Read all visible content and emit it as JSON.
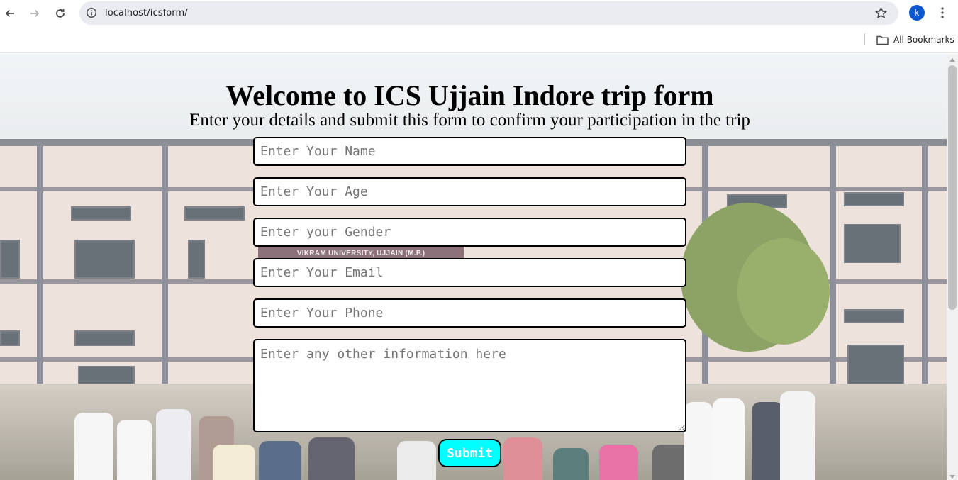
{
  "browser": {
    "url": "localhost/icsform/",
    "profile_initial": "k",
    "bookmarks_label": "All Bookmarks",
    "icons": [
      "back-arrow-icon",
      "forward-arrow-icon",
      "reload-icon",
      "site-info-icon",
      "bookmark-star-icon",
      "kebab-menu-icon",
      "folder-icon"
    ]
  },
  "page": {
    "title": "Welcome to ICS Ujjain Indore trip form",
    "subtitle": "Enter your details and submit this form to confirm your participation in the trip",
    "background_sign": "VIKRAM UNIVERSITY, UJJAIN (M.P.)",
    "form": {
      "name_placeholder": "Enter Your Name",
      "age_placeholder": "Enter Your Age",
      "gender_placeholder": "Enter your Gender",
      "email_placeholder": "Enter Your Email",
      "phone_placeholder": "Enter Your Phone",
      "info_placeholder": "Enter any other information here",
      "submit_label": "Submit"
    }
  },
  "colors": {
    "submit_bg": "#00ffff",
    "avatar_bg": "#0b57d0",
    "omnibox_bg": "#e9ebf1"
  }
}
